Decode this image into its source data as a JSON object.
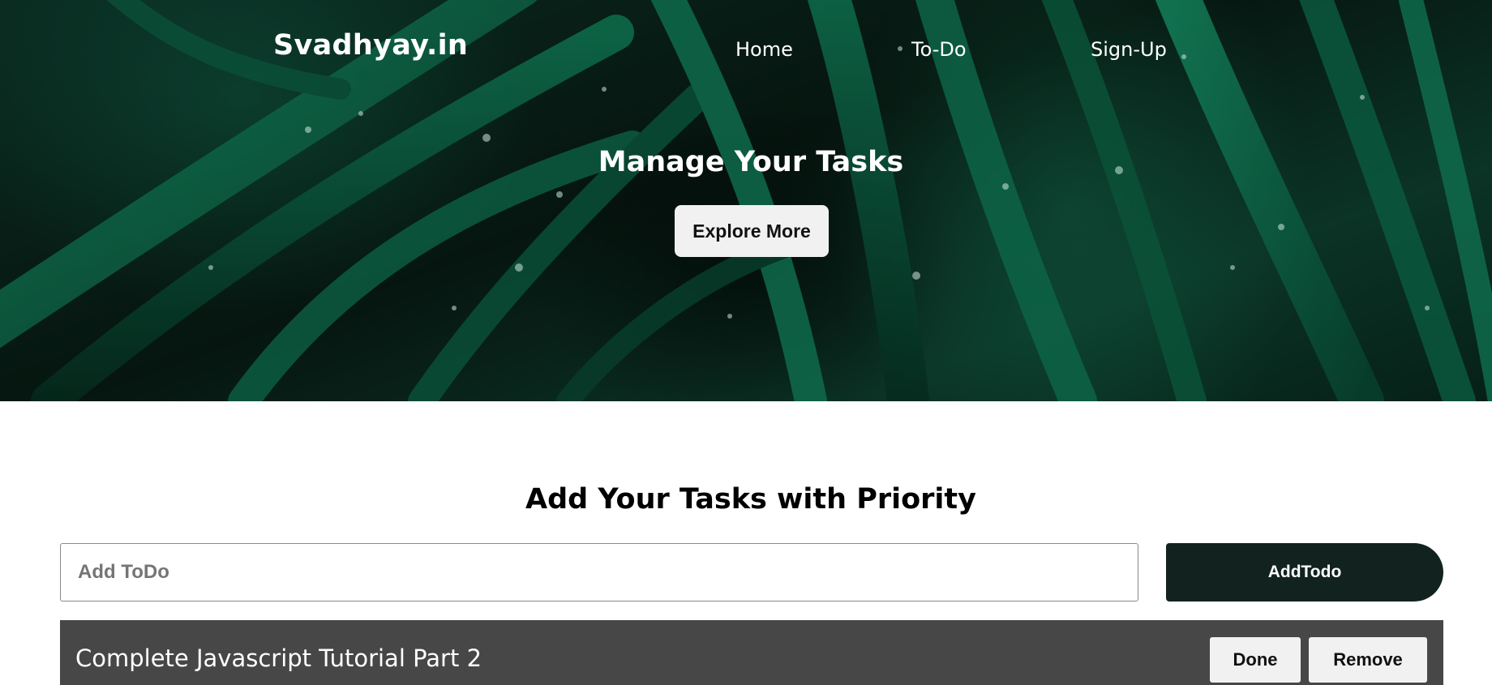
{
  "header": {
    "brand": "Svadhyay.in",
    "nav": {
      "home": "Home",
      "todo": "To-Do",
      "signup": "Sign-Up"
    }
  },
  "hero": {
    "title": "Manage Your Tasks",
    "button_label": "Explore More"
  },
  "main": {
    "section_title": "Add Your Tasks with Priority",
    "input": {
      "placeholder": "Add ToDo",
      "value": ""
    },
    "add_button_label": "AddTodo",
    "todos": [
      {
        "text": "Complete Javascript Tutorial Part 2",
        "done_label": "Done",
        "remove_label": "Remove"
      }
    ]
  },
  "colors": {
    "hero_dark_green": "#06150f",
    "leaf_green": "#0f6b4c",
    "add_button_bg": "#12231f",
    "todo_item_bg": "#474747"
  }
}
